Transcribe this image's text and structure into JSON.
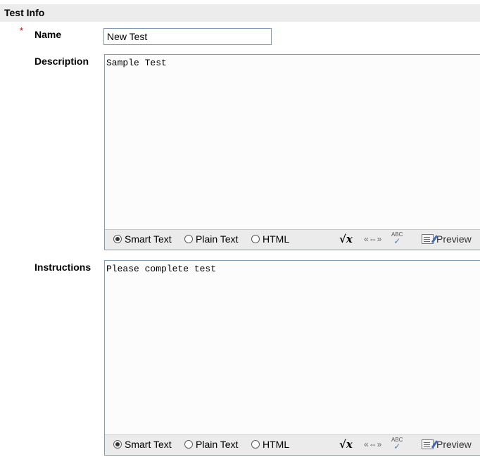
{
  "section": {
    "title": "Test Info"
  },
  "name_field": {
    "required_mark": "*",
    "label": "Name",
    "value": "New Test"
  },
  "description": {
    "label": "Description",
    "value": "Sample Test",
    "toolbar": {
      "smart_text": "Smart Text",
      "plain_text": "Plain Text",
      "html": "HTML",
      "equation_icon": "√x",
      "html_tags_icon": "«⇔»",
      "spellcheck_icon": "ABC",
      "preview": "Preview",
      "selected_format": "Smart Text"
    }
  },
  "instructions": {
    "label": "Instructions",
    "value": "Please complete test",
    "toolbar": {
      "smart_text": "Smart Text",
      "plain_text": "Plain Text",
      "html": "HTML",
      "equation_icon": "√x",
      "html_tags_icon": "«⇔»",
      "spellcheck_icon": "ABC",
      "preview": "Preview",
      "selected_format": "Smart Text"
    }
  },
  "colors": {
    "header_bg": "#ececec",
    "toolbar_bg": "#ebebeb",
    "border": "#7f9db9",
    "required": "#cc0000"
  }
}
